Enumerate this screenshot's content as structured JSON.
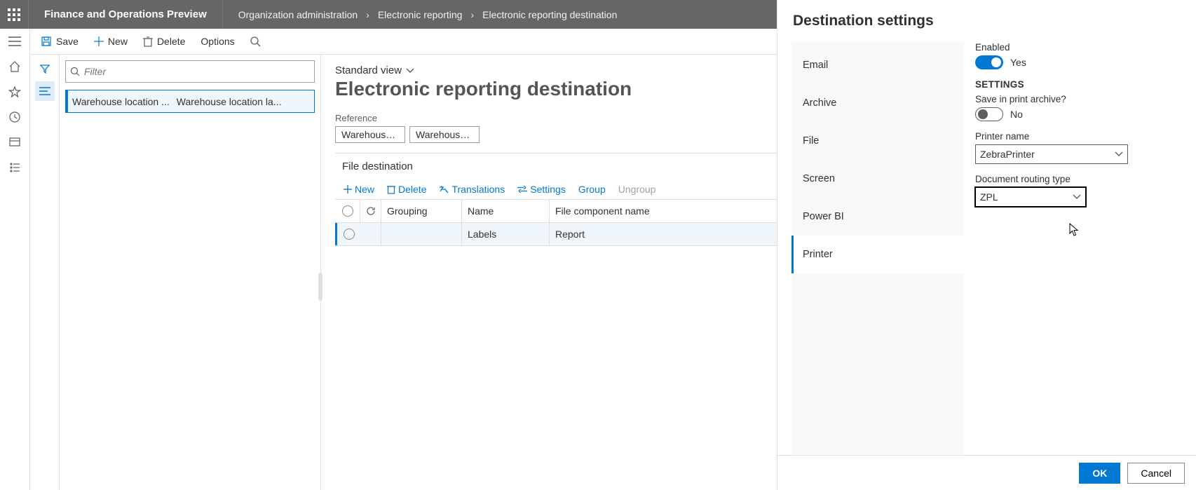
{
  "header": {
    "app_name": "Finance and Operations Preview",
    "breadcrumb": [
      "Organization administration",
      "Electronic reporting",
      "Electronic reporting destination"
    ]
  },
  "actionbar": {
    "save": "Save",
    "new": "New",
    "delete": "Delete",
    "options": "Options"
  },
  "filter": {
    "placeholder": "Filter"
  },
  "list": {
    "row0_a": "Warehouse location ...",
    "row0_b": "Warehouse location la..."
  },
  "detail": {
    "view": "Standard view",
    "title": "Electronic reporting destination",
    "reference_label": "Reference",
    "ref1": "Warehouse l...",
    "ref2": "Warehouse l...",
    "section": "File destination",
    "grid_toolbar": {
      "new": "New",
      "delete": "Delete",
      "translations": "Translations",
      "settings": "Settings",
      "group": "Group",
      "ungroup": "Ungroup"
    },
    "grid_headers": {
      "grouping": "Grouping",
      "name": "Name",
      "file": "File component name"
    },
    "grid_row": {
      "name": "Labels",
      "file": "Report"
    }
  },
  "panel": {
    "title": "Destination settings",
    "tabs": [
      "Email",
      "Archive",
      "File",
      "Screen",
      "Power BI",
      "Printer"
    ],
    "active_tab": "Printer",
    "enabled_label": "Enabled",
    "enabled_value": "Yes",
    "settings_heading": "SETTINGS",
    "save_archive_label": "Save in print archive?",
    "save_archive_value": "No",
    "printer_name_label": "Printer name",
    "printer_name_value": "ZebraPrinter",
    "routing_label": "Document routing type",
    "routing_value": "ZPL",
    "ok": "OK",
    "cancel": "Cancel"
  }
}
